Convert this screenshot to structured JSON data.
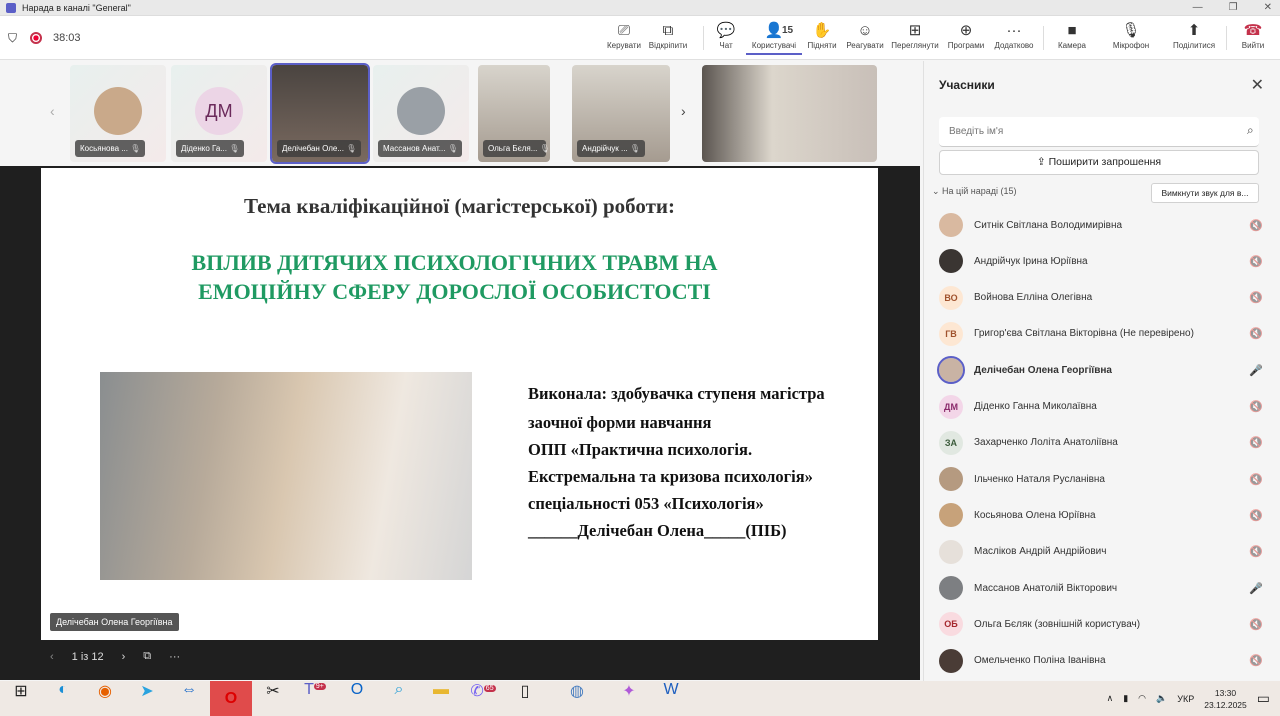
{
  "window": {
    "title": "Нарада в каналі \"General\""
  },
  "meeting": {
    "timer": "38:03"
  },
  "toolbar": [
    {
      "label": "Керувати",
      "icon": "monitor-pointer-icon",
      "glyph": "⎚"
    },
    {
      "label": "Відкріпити",
      "icon": "pop-out-icon",
      "glyph": "⧉"
    },
    {
      "label": "Чат",
      "icon": "chat-icon",
      "glyph": "💬"
    },
    {
      "label": "Користувачі",
      "icon": "people-icon",
      "glyph": "👤",
      "badge": "15",
      "active": true
    },
    {
      "label": "Підняти",
      "icon": "raise-hand-icon",
      "glyph": "✋"
    },
    {
      "label": "Реагувати",
      "icon": "emoji-icon",
      "glyph": "☺"
    },
    {
      "label": "Переглянути",
      "icon": "grid-icon",
      "glyph": "⊞"
    },
    {
      "label": "Програми",
      "icon": "apps-add-icon",
      "glyph": "⊕"
    },
    {
      "label": "Додатково",
      "icon": "more-icon",
      "glyph": "···"
    },
    {
      "label": "Камера",
      "icon": "camera-icon",
      "glyph": "■"
    },
    {
      "label": "Мікрофон",
      "icon": "mic-off-icon",
      "glyph": "🎙"
    },
    {
      "label": "Поділитися",
      "icon": "share-icon",
      "glyph": "⬆"
    },
    {
      "label": "Вийти",
      "icon": "hang-up-icon",
      "glyph": "☎"
    }
  ],
  "tiles": [
    {
      "name": "Косьянова ...",
      "type": "photo"
    },
    {
      "name": "Діденко Га...",
      "type": "initials",
      "initials": "ДМ"
    },
    {
      "name": "Делічебан Оле...",
      "type": "video",
      "selected": true
    },
    {
      "name": "Массанов Анат...",
      "type": "photo"
    },
    {
      "name": "Ольга Бєля...",
      "type": "video"
    },
    {
      "name": "Андрійчук ...",
      "type": "video"
    },
    {
      "name": "",
      "type": "video"
    }
  ],
  "slide": {
    "heading": "Тема кваліфікаційної (магістерської) роботи:",
    "title_line1": "ВПЛИВ ДИТЯЧИХ ПСИХОЛОГІЧНИХ ТРАВМ НА",
    "title_line2": "ЕМОЦІЙНУ СФЕРУ ДОРОСЛОЇ ОСОБИСТОСТІ",
    "info": [
      "Виконала: здобувачка ступеня магістра",
      "заочної форми навчання",
      "ОПП «Практична психологія.",
      "Екстремальна та кризова психологія»",
      "спеціальності 053 «Психологія»",
      "______Делічебан Олена_____(ПІБ)"
    ],
    "title_color": "#1f9a62"
  },
  "presenter": "Делічебан Олена Георгіївна",
  "slide_nav": {
    "page": "1 із 12"
  },
  "panel": {
    "title": "Учасники",
    "search_placeholder": "Введіть ім'я",
    "invite_label": "Поширити запрошення",
    "section": "На цій нараді (15)",
    "mute_all": "Вимкнути звук для в...",
    "participants": [
      {
        "name": "Ситнік Світлана Володимирівна",
        "mic": "off"
      },
      {
        "name": "Андрійчук Ірина Юріївна",
        "mic": "off"
      },
      {
        "name": "Войнова Елліна Олегівна",
        "initials": "ВО",
        "mic": "off"
      },
      {
        "name": "Григор'єва Світлана Вікторівна (Не перевірено)",
        "initials": "ГВ",
        "mic": "off"
      },
      {
        "name": "Делічебан Олена Георгіївна",
        "mic": "on",
        "speaking": true
      },
      {
        "name": "Діденко Ганна Миколаївна",
        "initials": "ДМ",
        "mic": "off"
      },
      {
        "name": "Захарченко Лоліта Анатоліївна",
        "initials": "ЗА",
        "mic": "off"
      },
      {
        "name": "Ільченко Наталя Русланівна",
        "mic": "off"
      },
      {
        "name": "Косьянова Олена Юріївна",
        "mic": "off"
      },
      {
        "name": "Масліков Андрій Андрійович",
        "mic": "off"
      },
      {
        "name": "Массанов Анатолій Вікторович",
        "mic": "on"
      },
      {
        "name": "Ольга Бєляк (зовнішній користувач)",
        "initials": "ОБ",
        "mic": "off"
      },
      {
        "name": "Омельченко Поліна Іванівна",
        "mic": "off"
      }
    ]
  },
  "taskbar": {
    "icons": [
      "windows-start-icon",
      "edge-icon",
      "firefox-icon",
      "telegram-icon",
      "teamviewer-icon",
      "opera-icon",
      "snipping-icon",
      "teams-icon",
      "outlook-icon",
      "search-app-icon",
      "file-explorer-icon",
      "viber-icon",
      "file-icon",
      "globe-icon",
      "copilot-icon",
      "word-icon"
    ],
    "teams_badge": "9+",
    "viber_badge": "65",
    "lang": "УКР",
    "time": "13:30",
    "date": "23.12.2025"
  }
}
